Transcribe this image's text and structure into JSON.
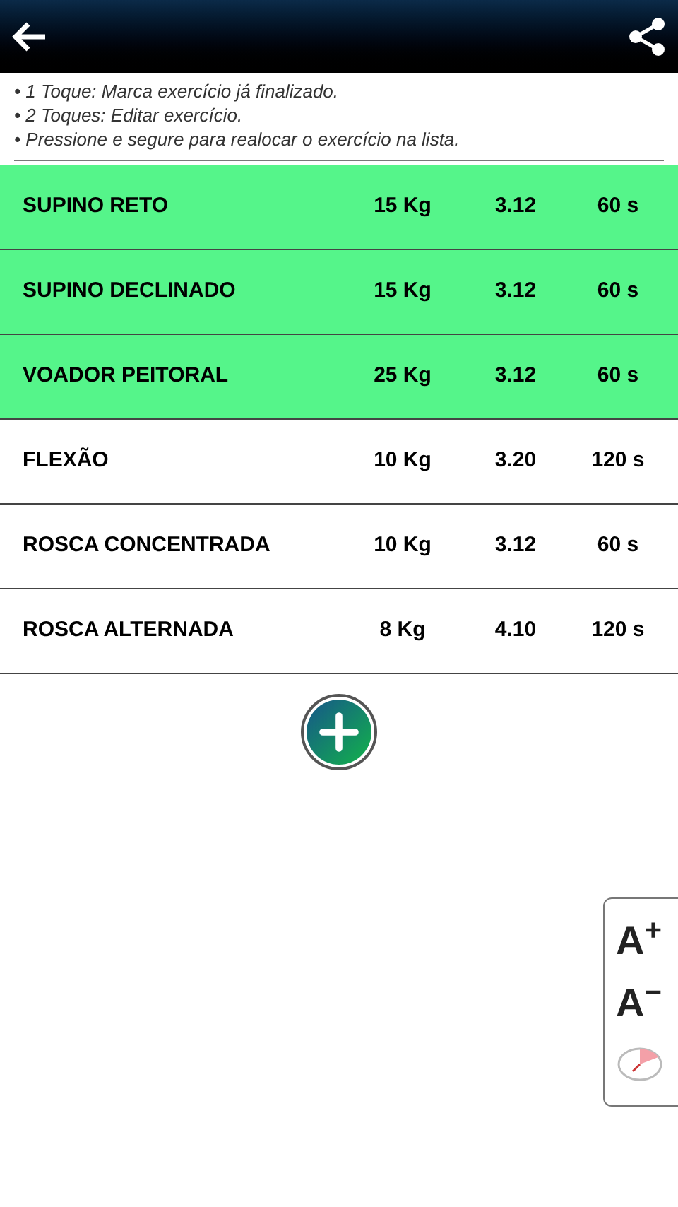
{
  "instructions": [
    "• 1 Toque: Marca exercício já finalizado.",
    "• 2 Toques: Editar exercício.",
    "• Pressione e segure para realocar o exercício na lista."
  ],
  "exercises": [
    {
      "name": "SUPINO RETO",
      "weight": "15 Kg",
      "sets": "3.12",
      "rest": "60 s",
      "done": true
    },
    {
      "name": "SUPINO DECLINADO",
      "weight": "15 Kg",
      "sets": "3.12",
      "rest": "60 s",
      "done": true
    },
    {
      "name": "VOADOR PEITORAL",
      "weight": "25 Kg",
      "sets": "3.12",
      "rest": "60 s",
      "done": true
    },
    {
      "name": "FLEXÃO",
      "weight": "10 Kg",
      "sets": "3.20",
      "rest": "120 s",
      "done": false
    },
    {
      "name": "ROSCA CONCENTRADA",
      "weight": "10 Kg",
      "sets": "3.12",
      "rest": "60 s",
      "done": false
    },
    {
      "name": "ROSCA ALTERNADA",
      "weight": "8 Kg",
      "sets": "4.10",
      "rest": "120 s",
      "done": false
    }
  ],
  "font_buttons": [
    "A$^{+}$",
    "A$^{−}$"
  ]
}
